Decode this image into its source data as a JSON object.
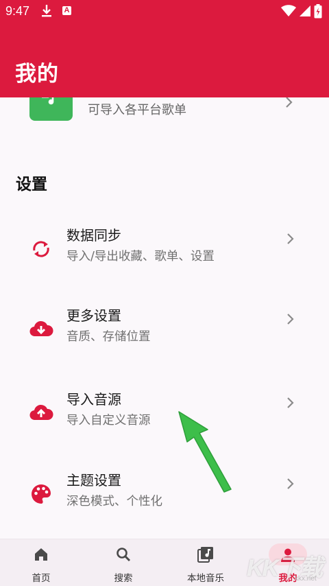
{
  "status_bar": {
    "time": "9:47",
    "notification_icons": [
      "download-icon",
      "a-icon"
    ],
    "system_icons": [
      "wifi-icon",
      "signal-icon",
      "battery-icon"
    ]
  },
  "app_bar": {
    "title": "我的",
    "color": "#DC1A3E"
  },
  "import_playlist": {
    "subtitle": "可导入各平台歌单",
    "tile_color": "#3FB65A"
  },
  "settings": {
    "section_title": "设置",
    "items": [
      {
        "icon": "sync-icon",
        "title": "数据同步",
        "subtitle": "导入/导出收藏、歌单、设置"
      },
      {
        "icon": "cloud-download-icon",
        "title": "更多设置",
        "subtitle": "音质、存储位置"
      },
      {
        "icon": "cloud-upload-icon",
        "title": "导入音源",
        "subtitle": "导入自定义音源"
      },
      {
        "icon": "palette-icon",
        "title": "主题设置",
        "subtitle": "深色模式、个性化"
      }
    ]
  },
  "annotation": {
    "icon": "arrow-icon",
    "color": "#3DBE4A"
  },
  "bottom_nav": {
    "items": [
      {
        "icon": "home-icon",
        "label": "首页"
      },
      {
        "icon": "search-icon",
        "label": "搜索"
      },
      {
        "icon": "music-library-icon",
        "label": "本地音乐"
      },
      {
        "icon": "person-icon",
        "label": "我的",
        "active": true
      }
    ]
  },
  "watermark": {
    "text": "KK下载",
    "sub": "kkx.net"
  },
  "colors": {
    "accent": "#DC1A3E",
    "background": "#FBF8FB",
    "nav_background": "#F4EEF3"
  }
}
